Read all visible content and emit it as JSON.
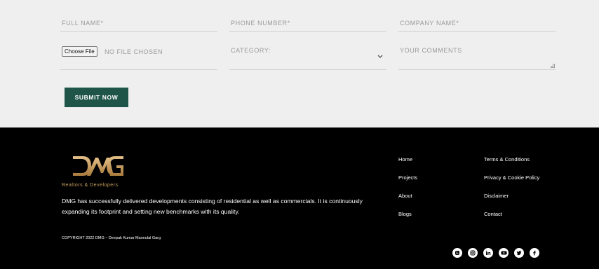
{
  "form": {
    "full_name_placeholder": "FULL NAME*",
    "phone_placeholder": "PHONE NUMBER*",
    "company_placeholder": "COMPANY NAME*",
    "choose_file_label": "Choose File",
    "no_file_text": "NO FILE CHOSEN",
    "category_placeholder": "CATEGORY:",
    "comments_placeholder": "YOUR COMMENTS",
    "submit_label": "SUBMIT NOW"
  },
  "footer": {
    "logo_text": "DMG",
    "logo_tagline": "Realtors & Developers",
    "about": "DMG has successfully delivered developments consisting of residential as well as commercials. It is continuously expanding its footprint and setting new benchmarks with its quality.",
    "copyright": "COPYRIGHT 2022 DMG – Deepak Kumar Mannulal Garg",
    "links_col1": [
      "Home",
      "Projects",
      "About",
      "Blogs"
    ],
    "links_col2": [
      "Terms & Conditions",
      "Privacy & Cookie Policy",
      "Disclaimer",
      "Contact"
    ],
    "socials": [
      "blogger-icon",
      "instagram-icon",
      "linkedin-icon",
      "youtube-icon",
      "twitter-icon",
      "facebook-icon"
    ],
    "brand_color": "#c9a160",
    "accent_color": "#1f5449"
  }
}
